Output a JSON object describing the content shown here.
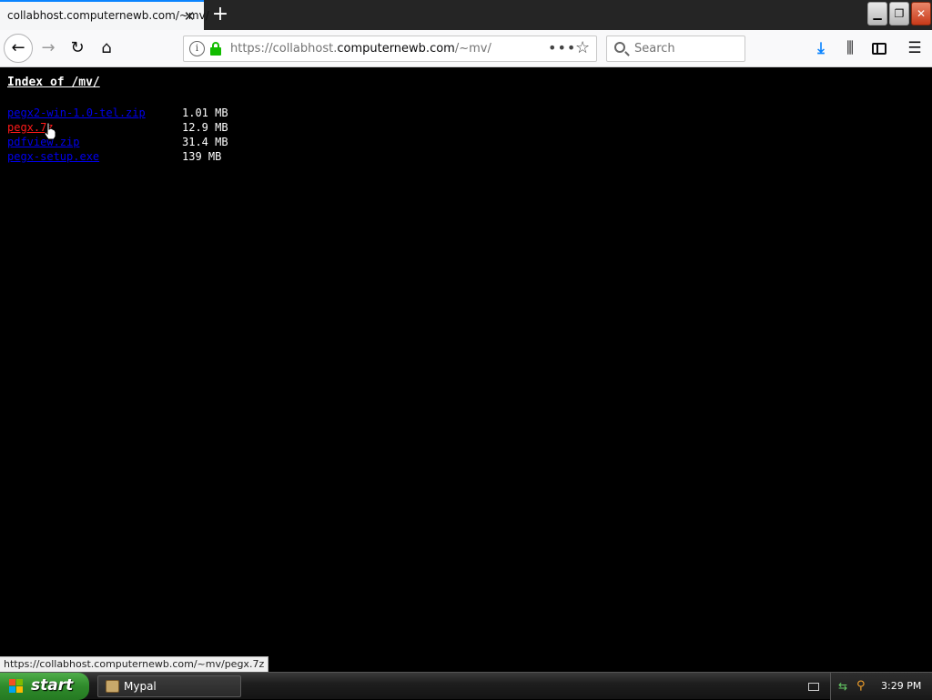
{
  "browser": {
    "tab_title": "collabhost.computernewb.com/~mv/",
    "url_prefix": "https://collabhost.",
    "url_host": "computernewb.com",
    "url_path": "/~mv/",
    "search_placeholder": "Search",
    "status_url": "https://collabhost.computernewb.com/~mv/pegx.7z"
  },
  "page": {
    "title": "Index of /mv/",
    "files": [
      {
        "name": "pegx2-win-1.0-tel.zip",
        "size": "1.01 MB",
        "active": false
      },
      {
        "name": "pegx.7z",
        "size": "12.9 MB",
        "active": true
      },
      {
        "name": "pdfview.zip",
        "size": "31.4 MB",
        "active": false
      },
      {
        "name": "pegx-setup.exe",
        "size": "139 MB",
        "active": false
      }
    ]
  },
  "taskbar": {
    "start_label": "start",
    "task_label": "Mypal",
    "clock": "3:29 PM"
  },
  "colors": {
    "link": "#0000ee",
    "link_active": "#ff1a1a",
    "accent": "#0a84ff",
    "lock": "#12bc00"
  },
  "icons": [
    "back-icon",
    "forward-icon",
    "reload-icon",
    "home-icon",
    "info-icon",
    "lock-icon",
    "more-icon",
    "star-icon",
    "search-icon",
    "download-icon",
    "library-icon",
    "sidebar-icon",
    "menu-icon",
    "close-icon",
    "plus-icon",
    "windows-flag-icon"
  ]
}
